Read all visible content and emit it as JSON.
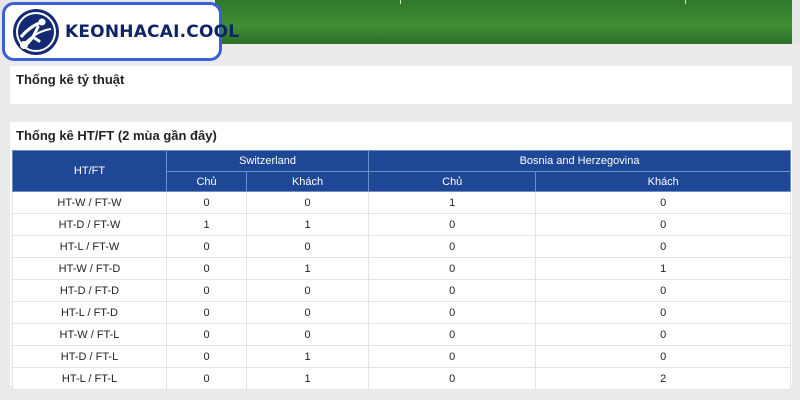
{
  "logo": {
    "text": "KEONHACAI.COOL"
  },
  "colors": {
    "header_bg": "#1e4796",
    "logo_border": "#3b5fd6",
    "logo_text": "#0f2466"
  },
  "odds_section": {
    "title": "Thống kê tỷ thuật"
  },
  "htft_section": {
    "title": "Thống kê HT/FT (2 mùa gần đây)",
    "corner_header": "HT/FT",
    "teams": [
      {
        "name": "Switzerland",
        "sub": [
          "Chủ",
          "Khách"
        ]
      },
      {
        "name": "Bosnia and Herzegovina",
        "sub": [
          "Chủ",
          "Khách"
        ]
      }
    ],
    "rows": [
      {
        "label": "HT-W / FT-W",
        "values": [
          "0",
          "0",
          "1",
          "0"
        ]
      },
      {
        "label": "HT-D / FT-W",
        "values": [
          "1",
          "1",
          "0",
          "0"
        ]
      },
      {
        "label": "HT-L / FT-W",
        "values": [
          "0",
          "0",
          "0",
          "0"
        ]
      },
      {
        "label": "HT-W / FT-D",
        "values": [
          "0",
          "1",
          "0",
          "1"
        ]
      },
      {
        "label": "HT-D / FT-D",
        "values": [
          "0",
          "0",
          "0",
          "0"
        ]
      },
      {
        "label": "HT-L / FT-D",
        "values": [
          "0",
          "0",
          "0",
          "0"
        ]
      },
      {
        "label": "HT-W / FT-L",
        "values": [
          "0",
          "0",
          "0",
          "0"
        ]
      },
      {
        "label": "HT-D / FT-L",
        "values": [
          "0",
          "1",
          "0",
          "0"
        ]
      },
      {
        "label": "HT-L / FT-L",
        "values": [
          "0",
          "1",
          "0",
          "2"
        ]
      }
    ]
  }
}
